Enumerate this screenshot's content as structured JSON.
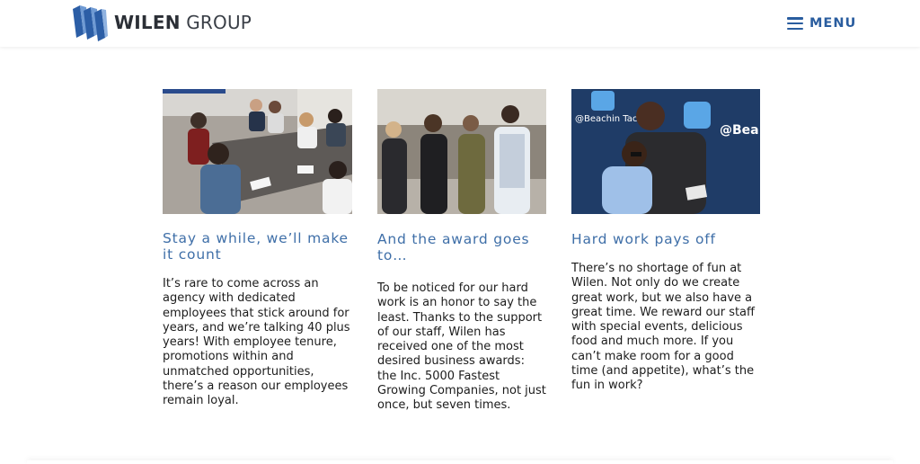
{
  "header": {
    "logo_bold": "WILEN",
    "logo_light": "GROUP",
    "menu_label": "MENU"
  },
  "cards": [
    {
      "title": "Stay a while, we’ll make it count",
      "body": "It’s rare to come across an agency with dedicated employees that stick around for years, and we’re talking 40 plus years! With employee tenure, promotions within and unmatched opportunities, there’s a reason our employees remain loyal."
    },
    {
      "title": "And the award goes to…",
      "body": "To be noticed for our hard work is an honor to say the least. Thanks to the support of our staff, Wilen has received one of the most desired business awards: the Inc. 5000 Fastest Growing Companies, not just once, but seven times."
    },
    {
      "title": "Hard work pays off",
      "body": "There’s no shortage of fun at Wilen. Not only do we create great work, but we also have a great time. We reward our staff with special events, delicious food and much more. If you can’t make room for a good time (and appetite), what’s the fun in work?"
    }
  ],
  "photo_3_sign_text": "@Beachin Tacos",
  "colors": {
    "accent": "#3f6fa8",
    "menu": "#2a5d9f",
    "logo_blue": "#2c5ea6"
  },
  "icons": {
    "menu": "hamburger-icon",
    "logo": "wilen-logo-icon"
  }
}
